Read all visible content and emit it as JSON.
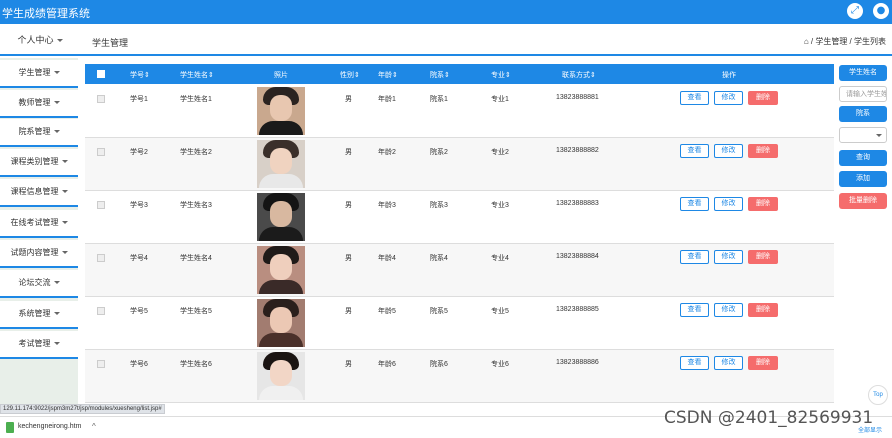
{
  "header": {
    "title": "学生成绩管理系统",
    "icons": [
      "expand-icon",
      "user-icon"
    ]
  },
  "nav": {
    "personal_center": "个人中心",
    "page_title": "学生管理",
    "breadcrumb": "⌂ / 学生管理 / 学生列表"
  },
  "sidebar": {
    "items": [
      {
        "label": "学生管理"
      },
      {
        "label": "教师管理"
      },
      {
        "label": "院系管理"
      },
      {
        "label": "课程类别管理"
      },
      {
        "label": "课程信息管理"
      },
      {
        "label": "在线考试管理"
      },
      {
        "label": "试题内容管理"
      },
      {
        "label": "论坛交流"
      },
      {
        "label": "系统管理"
      },
      {
        "label": "考试管理"
      }
    ]
  },
  "table": {
    "headers": [
      "学号⇕",
      "学生姓名⇕",
      "照片",
      "性别⇕",
      "年龄⇕",
      "院系⇕",
      "专业⇕",
      "联系方式⇕",
      "操作"
    ],
    "rows": [
      {
        "id": "学号1",
        "name": "学生姓名1",
        "gender": "男",
        "age": "年龄1",
        "dept": "院系1",
        "major": "专业1",
        "phone": "13823888881"
      },
      {
        "id": "学号2",
        "name": "学生姓名2",
        "gender": "男",
        "age": "年龄2",
        "dept": "院系2",
        "major": "专业2",
        "phone": "13823888882"
      },
      {
        "id": "学号3",
        "name": "学生姓名3",
        "gender": "男",
        "age": "年龄3",
        "dept": "院系3",
        "major": "专业3",
        "phone": "13823888883"
      },
      {
        "id": "学号4",
        "name": "学生姓名4",
        "gender": "男",
        "age": "年龄4",
        "dept": "院系4",
        "major": "专业4",
        "phone": "13823888884"
      },
      {
        "id": "学号5",
        "name": "学生姓名5",
        "gender": "男",
        "age": "年龄5",
        "dept": "院系5",
        "major": "专业5",
        "phone": "13823888885"
      },
      {
        "id": "学号6",
        "name": "学生姓名6",
        "gender": "男",
        "age": "年龄6",
        "dept": "院系6",
        "major": "专业6",
        "phone": "13823888886"
      }
    ],
    "actions": {
      "view": "查看",
      "edit": "修改",
      "delete": "删除"
    }
  },
  "right_panel": {
    "student_name_label": "学生姓名",
    "search_placeholder": "请输入学生姓名",
    "dept_label": "院系",
    "query": "查询",
    "add": "添加",
    "batch_delete": "批量删除"
  },
  "top_button": "Top",
  "status": {
    "url": "129.11.174:9022/jspm3m27t/jsp/modules/xuesheng/list.jsp#",
    "download_name": "kechengneirong.htm",
    "download_sep": "^",
    "show_all": "全部显示"
  },
  "watermark": "CSDN @2401_82569931",
  "colors": {
    "primary": "#1e88e5",
    "danger": "#f56c6c"
  }
}
